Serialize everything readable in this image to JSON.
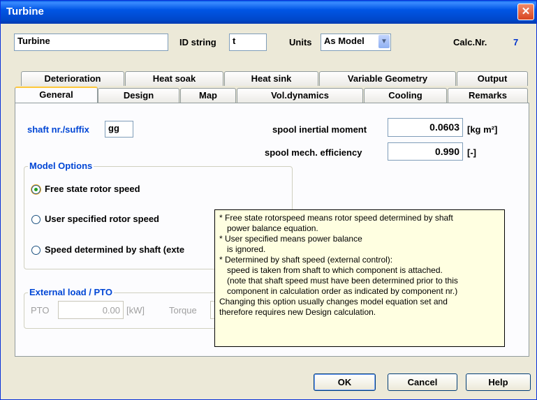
{
  "window": {
    "title": "Turbine",
    "close_glyph": "✕"
  },
  "header": {
    "name_value": "Turbine",
    "id_label": "ID string",
    "id_value": "t",
    "units_label": "Units",
    "units_value": "As Model",
    "calc_label": "Calc.Nr.",
    "calc_value": "7"
  },
  "tabs_back": [
    "Deterioration",
    "Heat soak",
    "Heat sink",
    "Variable Geometry",
    "Output"
  ],
  "tabs_front": [
    "General",
    "Design",
    "Map",
    "Vol.dynamics",
    "Cooling",
    "Remarks"
  ],
  "general": {
    "shaft_label": "shaft nr./suffix",
    "shaft_value": "gg",
    "inertia_label": "spool inertial moment",
    "inertia_value": "0.0603",
    "inertia_unit": "[kg m²]",
    "efficiency_label": "spool mech. efficiency",
    "efficiency_value": "0.990",
    "efficiency_unit": "[-]",
    "model_options_title": "Model Options",
    "option_free": "Free state rotor speed",
    "option_user": "User specified rotor speed",
    "option_shaft": "Speed determined by shaft (exte",
    "load_title": "External load / PTO",
    "pto_label": "PTO",
    "pto_value": "0.00",
    "pto_unit": "[kW]",
    "torque_label": "Torque"
  },
  "tooltip": {
    "lines": [
      "* Free state rotorspeed means rotor speed determined by shaft",
      "  power balance equation.",
      "* User specified means power balance",
      "  is ignored.",
      "* Determined by shaft speed (external control):",
      "  speed is taken from shaft to which component is attached.",
      "  (note that shaft speed must have been determined prior to this",
      "  component in calculation order as indicated by component nr.)",
      "Changing this option usually changes model equation set and",
      "therefore requires new Design calculation."
    ]
  },
  "buttons": {
    "ok": "OK",
    "cancel": "Cancel",
    "help": "Help"
  },
  "colors": {
    "group_title": "#0046d5",
    "titlebar": "#0055e5",
    "tooltip_bg": "#ffffe1"
  }
}
